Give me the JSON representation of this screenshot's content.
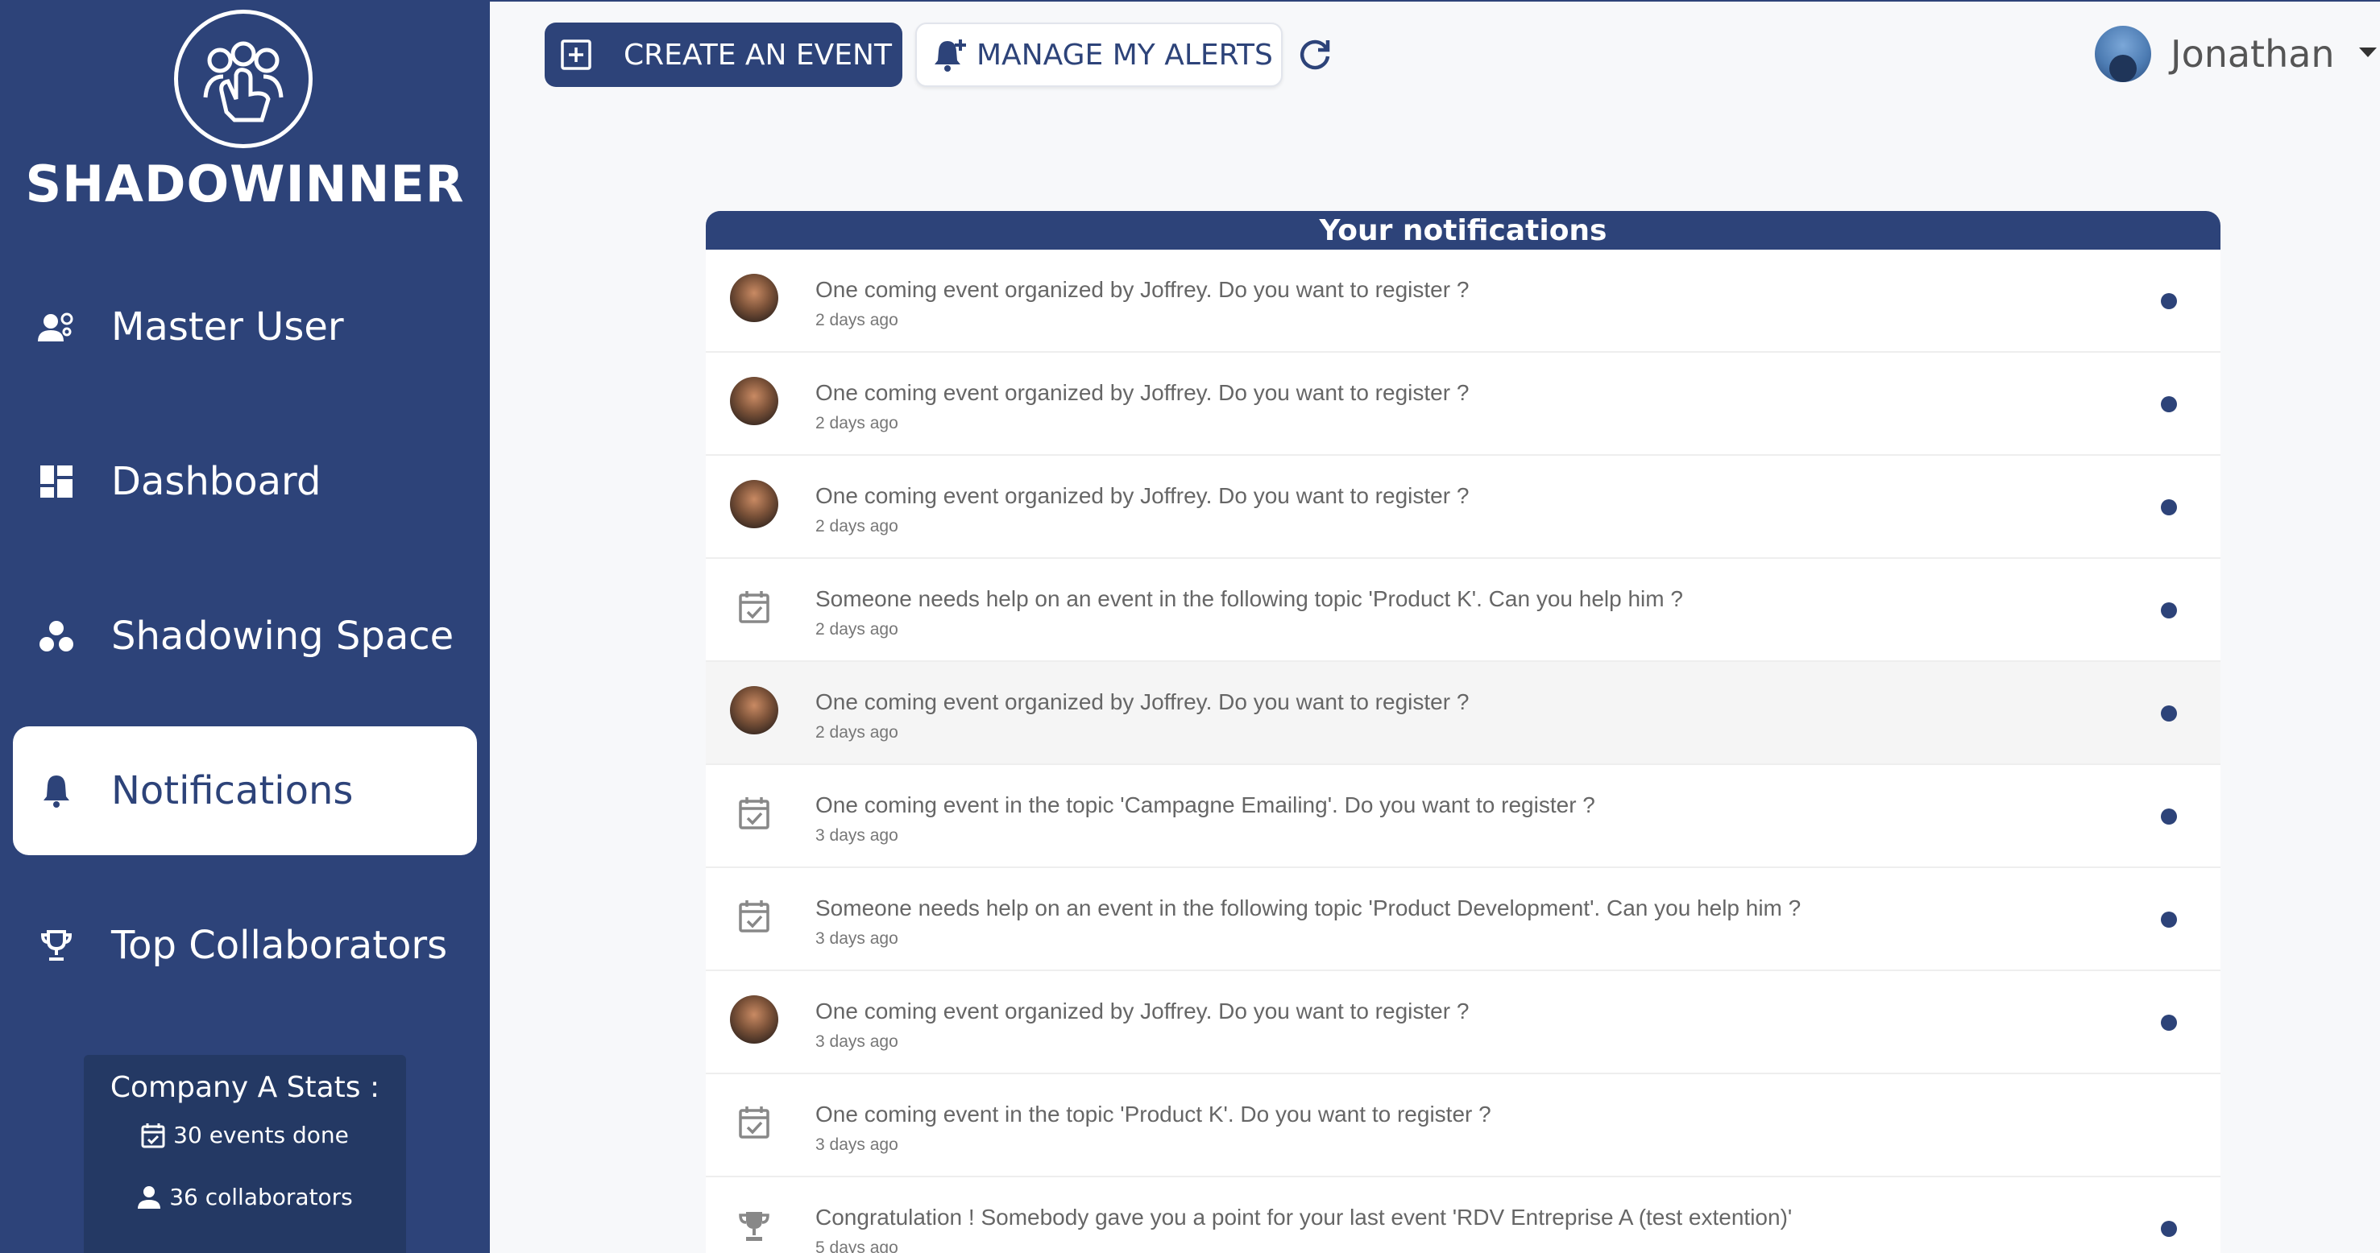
{
  "brand": {
    "name": "SHADOWINNER",
    "logo_icon": "people-hand-logo-icon"
  },
  "sidebar": {
    "items": [
      {
        "label": "Master User",
        "icon": "user-gear-icon",
        "active": false
      },
      {
        "label": "Dashboard",
        "icon": "dashboard-icon",
        "active": false
      },
      {
        "label": "Shadowing Space",
        "icon": "bubbles-icon",
        "active": false
      },
      {
        "label": "Notifications",
        "icon": "bell-icon",
        "active": true
      },
      {
        "label": "Top Collaborators",
        "icon": "trophy-icon",
        "active": false
      }
    ],
    "stats": {
      "title": "Company A Stats :",
      "events": "30 events done",
      "collaborators": "36 collaborators"
    }
  },
  "toolbar": {
    "create_label": "CREATE AN EVENT",
    "alerts_label": "MANAGE MY ALERTS"
  },
  "user": {
    "name": "Jonathan"
  },
  "panel": {
    "title": "Your notifications",
    "notifications": [
      {
        "icon": "avatar",
        "text": "One coming event organized by Joffrey. Do you want to register ?",
        "time": "2 days ago",
        "unread": true
      },
      {
        "icon": "avatar",
        "text": "One coming event organized by Joffrey. Do you want to register ?",
        "time": "2 days ago",
        "unread": true
      },
      {
        "icon": "avatar",
        "text": "One coming event organized by Joffrey. Do you want to register ?",
        "time": "2 days ago",
        "unread": true
      },
      {
        "icon": "calendar-check-icon",
        "text": "Someone needs help on an event in the following topic 'Product K'. Can you help him ?",
        "time": "2 days ago",
        "unread": true
      },
      {
        "icon": "avatar",
        "text": "One coming event organized by Joffrey. Do you want to register ?",
        "time": "2 days ago",
        "unread": true,
        "highlighted": true
      },
      {
        "icon": "calendar-check-icon",
        "text": "One coming event in the topic 'Campagne Emailing'. Do you want to register ?",
        "time": "3 days ago",
        "unread": true
      },
      {
        "icon": "calendar-check-icon",
        "text": "Someone needs help on an event in the following topic 'Product Development'. Can you help him ?",
        "time": "3 days ago",
        "unread": true
      },
      {
        "icon": "avatar",
        "text": "One coming event organized by Joffrey. Do you want to register ?",
        "time": "3 days ago",
        "unread": true
      },
      {
        "icon": "calendar-check-icon",
        "text": "One coming event in the topic 'Product K'. Do you want to register ?",
        "time": "3 days ago",
        "unread": false
      },
      {
        "icon": "trophy-icon",
        "text": "Congratulation ! Somebody gave you a point for your last event 'RDV Entreprise A (test extention)'",
        "time": "5 days ago",
        "unread": true
      }
    ]
  },
  "colors": {
    "primary": "#2d4379",
    "stats_bg": "#243964",
    "background": "#f7f8fa"
  }
}
